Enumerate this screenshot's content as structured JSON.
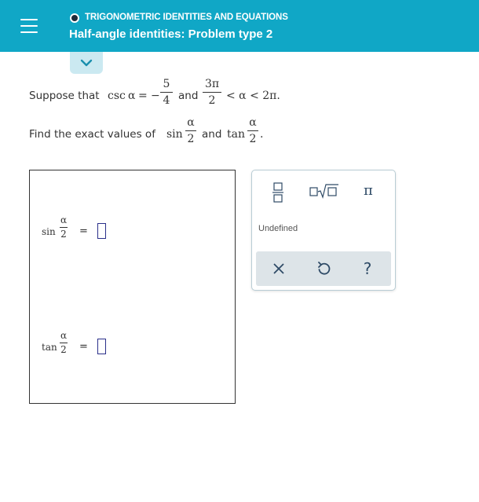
{
  "header": {
    "topic": "TRIGONOMETRIC IDENTITIES AND EQUATIONS",
    "title": "Half-angle identities: Problem type 2"
  },
  "problem": {
    "line1_prefix": "Suppose that",
    "csc": "csc",
    "alpha": "α",
    "equals": "=",
    "minus": "−",
    "given_num": "5",
    "given_den": "4",
    "and": "and",
    "range_num": "3π",
    "range_den": "2",
    "range_tail": "< α < 2π.",
    "line2_prefix": "Find the exact values of",
    "sin": "sin",
    "tan": "tan",
    "half_den": "2",
    "period": "."
  },
  "answers": [
    {
      "fn": "sin",
      "num": "α",
      "den": "2",
      "eq": "="
    },
    {
      "fn": "tan",
      "num": "α",
      "den": "2",
      "eq": "="
    }
  ],
  "palette": {
    "undefined_label": "Undefined",
    "pi_label": "π",
    "help_label": "?"
  },
  "colors": {
    "header_bg": "#10a7c6",
    "accent": "#2e4a66"
  }
}
